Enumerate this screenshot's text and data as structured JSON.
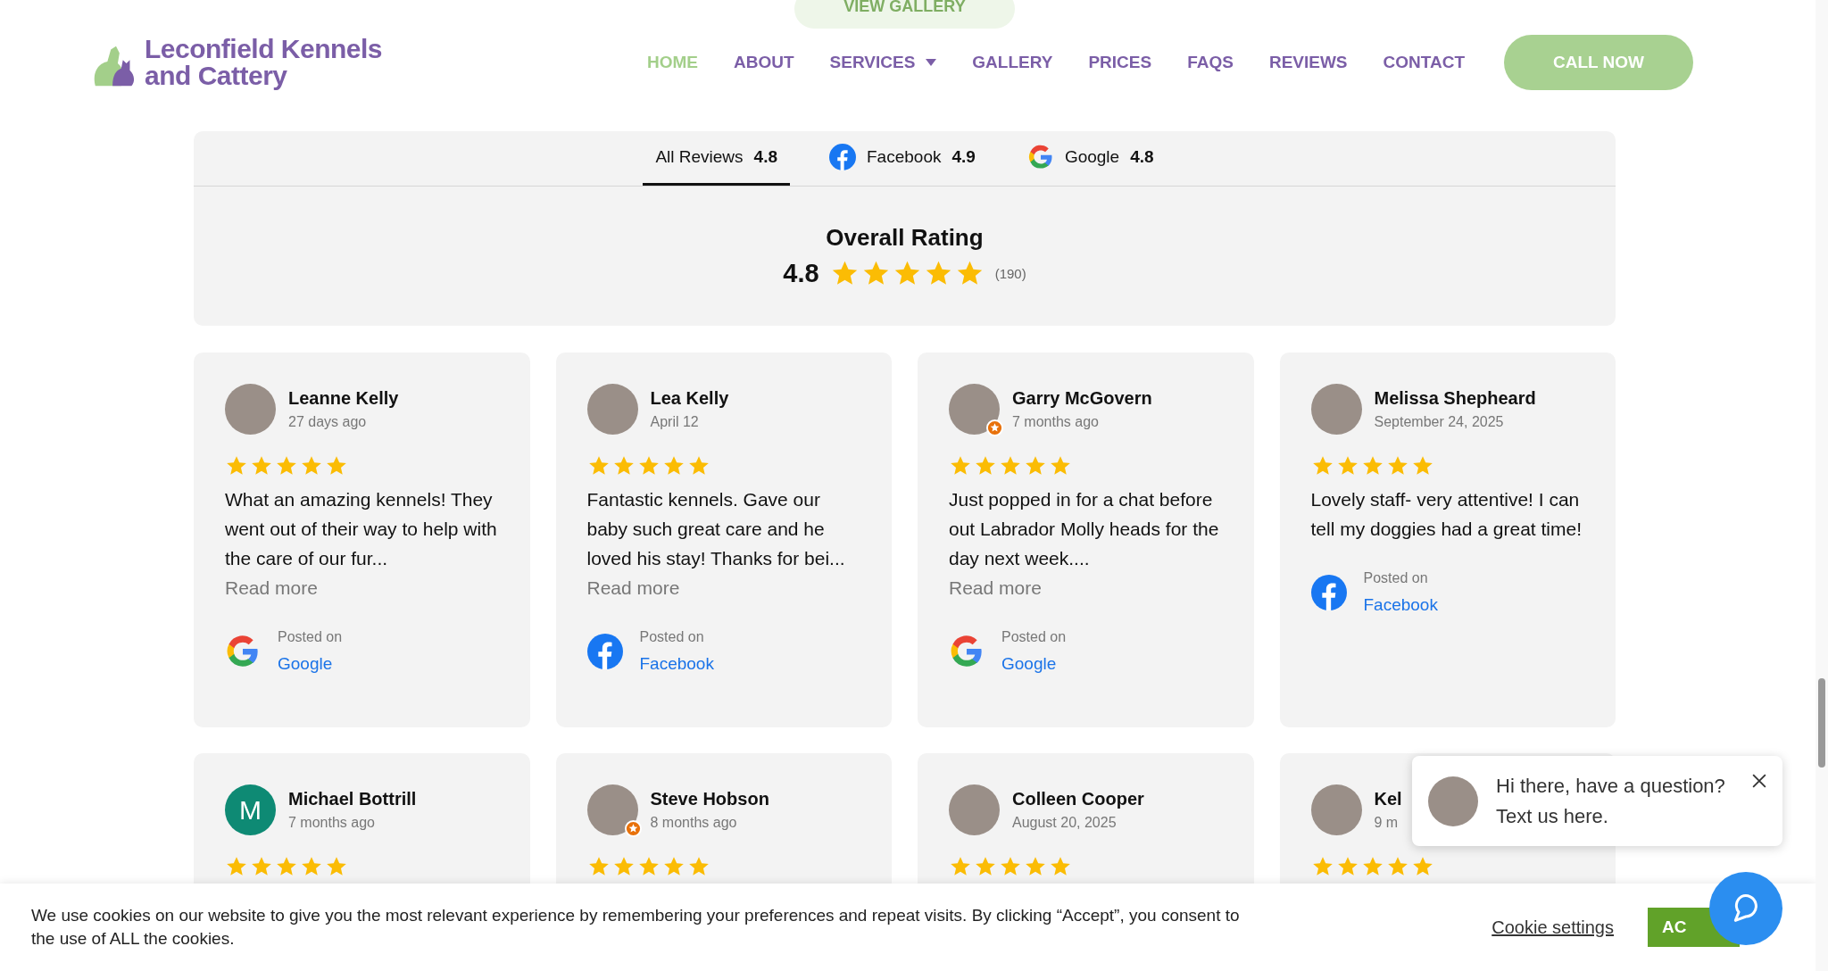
{
  "top_button": {
    "label": "VIEW GALLERY"
  },
  "logo": {
    "lines": [
      "Leconfield Kennels",
      "and Cattery"
    ]
  },
  "nav": [
    {
      "label": "HOME",
      "selected": true,
      "dropdown": false
    },
    {
      "label": "ABOUT",
      "selected": false,
      "dropdown": false
    },
    {
      "label": "SERVICES",
      "selected": false,
      "dropdown": true
    },
    {
      "label": "GALLERY",
      "selected": false,
      "dropdown": false
    },
    {
      "label": "PRICES",
      "selected": false,
      "dropdown": false
    },
    {
      "label": "FAQS",
      "selected": false,
      "dropdown": false
    },
    {
      "label": "REVIEWS",
      "selected": false,
      "dropdown": false
    },
    {
      "label": "CONTACT",
      "selected": false,
      "dropdown": false
    }
  ],
  "call_button": {
    "label": "CALL NOW"
  },
  "review_tabs": [
    {
      "kind": "all",
      "label": "All Reviews",
      "rating": "4.8",
      "selected": true
    },
    {
      "kind": "facebook",
      "label": "Facebook",
      "rating": "4.9",
      "selected": false
    },
    {
      "kind": "google",
      "label": "Google",
      "rating": "4.8",
      "selected": false
    }
  ],
  "overall": {
    "title": "Overall Rating",
    "rating": "4.8",
    "stars": 5,
    "count": "(190)"
  },
  "reviews": [
    {
      "name": "Leanne Kelly",
      "date": "27 days ago",
      "guide_badge": false,
      "stars": 5,
      "text": "What an amazing kennels! They went out of their way to help with the care of our fur...",
      "read_more": "Read more",
      "posted_label": "Posted on",
      "source": {
        "kind": "google",
        "name": "Google"
      }
    },
    {
      "name": "Lea Kelly",
      "date": "April 12",
      "guide_badge": false,
      "stars": 5,
      "text": "Fantastic kennels. Gave our baby such great care and he loved his stay! Thanks for bei...",
      "read_more": "Read more",
      "posted_label": "Posted on",
      "source": {
        "kind": "facebook",
        "name": "Facebook"
      }
    },
    {
      "name": "Garry McGovern",
      "date": "7 months ago",
      "guide_badge": true,
      "stars": 5,
      "text": "Just popped in for a chat before out Labrador Molly heads for the day next week....",
      "read_more": "Read more",
      "posted_label": "Posted on",
      "source": {
        "kind": "google",
        "name": "Google"
      }
    },
    {
      "name": "Melissa Shepheard",
      "date": "September 24, 2025",
      "guide_badge": false,
      "stars": 5,
      "text": "Lovely staff- very attentive! I can tell my doggies had a great time!",
      "posted_label": "Posted on",
      "source": {
        "kind": "facebook",
        "name": "Facebook"
      }
    },
    {
      "name": "Michael Bottrill",
      "date": "7 months ago",
      "letter": "M",
      "guide_badge": false,
      "stars": 5
    },
    {
      "name": "Steve Hobson",
      "date": "8 months ago",
      "guide_badge": true,
      "stars": 5
    },
    {
      "name": "Colleen Cooper",
      "date": "August 20, 2025",
      "guide_badge": false,
      "stars": 5
    },
    {
      "name": "Kel",
      "date": "9 m",
      "guide_badge": false,
      "stars": 5
    }
  ],
  "chat_popup": {
    "message": "Hi there, have a question? Text us here."
  },
  "cookie_bar": {
    "text": "We use cookies on our website to give you the most relevant experience by remembering your preferences and repeat visits. By clicking “Accept”, you consent to the use of ALL the cookies.",
    "settings_link": "Cookie settings",
    "accept_button": "AC"
  }
}
